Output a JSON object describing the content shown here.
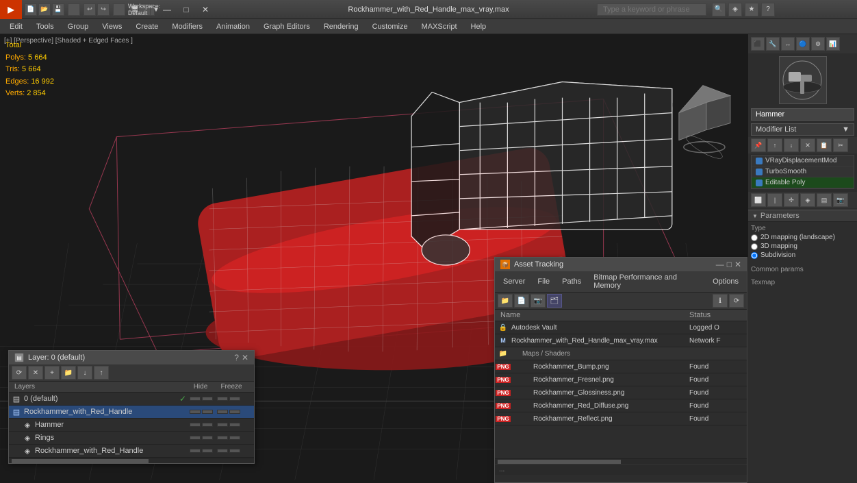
{
  "titlebar": {
    "app_name": "3",
    "title": "Rockhammer_with_Red_Handle_max_vray,max",
    "workspace_label": "Workspace: Default",
    "search_placeholder": "Type a keyword or phrase",
    "min_label": "—",
    "max_label": "□",
    "close_label": "✕"
  },
  "menubar": {
    "items": [
      "Edit",
      "Tools",
      "Group",
      "Views",
      "Create",
      "Modifiers",
      "Animation",
      "Graph Editors",
      "Rendering",
      "Customize",
      "MAXScript",
      "Help"
    ]
  },
  "viewport": {
    "label": "[+] [Perspective] [Shaded + Edged Faces ]",
    "stats": {
      "polys_label": "Polys:",
      "polys_val": "5 664",
      "tris_label": "Tris:",
      "tris_val": "5 664",
      "edges_label": "Edges:",
      "edges_val": "16 992",
      "verts_label": "Verts:",
      "verts_val": "2 854",
      "total_label": "Total"
    }
  },
  "right_panel": {
    "object_name": "Hammer",
    "modifier_list_label": "Modifier List",
    "modifier_list_arrow": "▼",
    "modifiers": [
      {
        "name": "VRayDisplacementMod",
        "active": false,
        "color": "blue"
      },
      {
        "name": "TurboSmooth",
        "active": false,
        "color": "blue"
      },
      {
        "name": "Editable Poly",
        "active": true,
        "color": "blue"
      }
    ],
    "modifier_tools": [
      "⟲",
      "⟳",
      "✕",
      "📋",
      "✂"
    ],
    "parameters_label": "Parameters",
    "type_label": "Type",
    "radio_options": [
      "2D mapping (landscape)",
      "3D mapping",
      "Subdivision"
    ],
    "selected_radio": "Subdivision",
    "common_params_label": "Common params",
    "texmap_label": "Texmap"
  },
  "layers_panel": {
    "title": "Layer: 0 (default)",
    "question_label": "?",
    "close_label": "✕",
    "toolbar_icons": [
      "⟳",
      "✕",
      "+",
      "📁",
      "↓",
      "↑"
    ],
    "col_name": "Layers",
    "col_hide": "Hide",
    "col_freeze": "Freeze",
    "layers": [
      {
        "indent": 0,
        "name": "0 (default)",
        "checked": true,
        "icon": "layer",
        "color": "default"
      },
      {
        "indent": 0,
        "name": "Rockhammer_with_Red_Handle",
        "checked": false,
        "icon": "layer",
        "color": "blue",
        "selected": true
      },
      {
        "indent": 1,
        "name": "Hammer",
        "checked": false,
        "icon": "object",
        "color": "default"
      },
      {
        "indent": 1,
        "name": "Rings",
        "checked": false,
        "icon": "object",
        "color": "default"
      },
      {
        "indent": 1,
        "name": "Rockhammer_with_Red_Handle",
        "checked": false,
        "icon": "object",
        "color": "default"
      }
    ]
  },
  "asset_tracking": {
    "title": "Asset Tracking",
    "min_label": "—",
    "max_label": "□",
    "close_label": "✕",
    "menu_items": [
      "Server",
      "File",
      "Paths",
      "Bitmap Performance and Memory",
      "Options"
    ],
    "toolbar_icons": [
      "📁",
      "📄",
      "📷",
      "🗂"
    ],
    "col_name": "Name",
    "col_status": "Status",
    "assets": [
      {
        "indent": 0,
        "name": "Autodesk Vault",
        "status": "Logged O",
        "icon": "vault",
        "type": "vault"
      },
      {
        "indent": 0,
        "name": "Rockhammer_with_Red_Handle_max_vray.max",
        "status": "Network F",
        "icon": "max",
        "type": "maxfile"
      },
      {
        "indent": 1,
        "name": "Maps / Shaders",
        "status": "",
        "icon": "folder",
        "type": "folder"
      },
      {
        "indent": 2,
        "name": "Rockhammer_Bump.png",
        "status": "Found",
        "icon": "png",
        "type": "texture"
      },
      {
        "indent": 2,
        "name": "Rockhammer_Fresnel.png",
        "status": "Found",
        "icon": "png",
        "type": "texture"
      },
      {
        "indent": 2,
        "name": "Rockhammer_Glossiness.png",
        "status": "Found",
        "icon": "png",
        "type": "texture"
      },
      {
        "indent": 2,
        "name": "Rockhammer_Red_Diffuse.png",
        "status": "Found",
        "icon": "png",
        "type": "texture"
      },
      {
        "indent": 2,
        "name": "Rockhammer_Reflect.png",
        "status": "Found",
        "icon": "png",
        "type": "texture"
      }
    ]
  },
  "icons": {
    "search": "🔍",
    "help": "?",
    "pin": "📌",
    "gear": "⚙",
    "close": "✕",
    "minus": "—",
    "maximize": "□",
    "arrow_down": "▼",
    "arrow_right": "▶",
    "check": "✓",
    "layer_icon": "▤",
    "object_icon": "◈",
    "folder_icon": "📁",
    "max_icon": "M",
    "vault_icon": "V",
    "png_icon": "P"
  }
}
